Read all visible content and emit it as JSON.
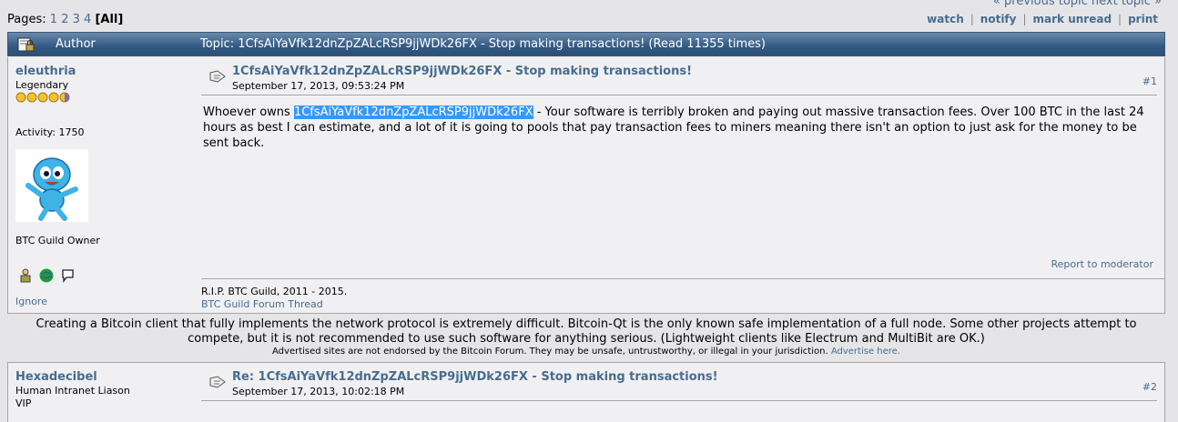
{
  "nav": {
    "prevnext": "« previous topic next topic »"
  },
  "pages": {
    "label": "Pages:",
    "items": [
      "1",
      "2",
      "3",
      "4"
    ],
    "current": "[All]"
  },
  "actions": [
    "watch",
    "notify",
    "mark unread",
    "print"
  ],
  "header": {
    "author_label": "Author",
    "topic_label": "Topic: 1CfsAiYaVfk12dnZpZALcRSP9jjWDk26FX - Stop making transactions!  (Read 11355 times)"
  },
  "posts": [
    {
      "author": "eleuthria",
      "rank": "Legendary",
      "activity": "Activity: 1750",
      "personal_title": "BTC Guild Owner",
      "ignore": "Ignore",
      "subject": "1CfsAiYaVfk12dnZpZALcRSP9jjWDk26FX - Stop making transactions!",
      "date": "September 17, 2013, 09:53:24 PM",
      "number": "#1",
      "content_prefix": "Whoever owns ",
      "content_highlight": "1CfsAiYaVfk12dnZpZALcRSP9jjWDk26FX",
      "content_suffix": " - Your software is terribly broken and paying out massive transaction fees.  Over 100 BTC in the last 24 hours as best I can estimate, and a lot of it is going to pools that pay transaction fees to miners meaning there isn't an option to just ask for the money to be sent back.",
      "report": "Report to moderator",
      "signature_line1": "R.I.P. BTC Guild, 2011 - 2015.",
      "signature_link": "BTC Guild Forum Thread"
    },
    {
      "author": "Hexadecibel",
      "rank": "Human Intranet Liason",
      "rank2": "VIP",
      "subject": "Re: 1CfsAiYaVfk12dnZpZALcRSP9jjWDk26FX - Stop making transactions!",
      "date": "September 17, 2013, 10:02:18 PM",
      "number": "#2"
    }
  ],
  "notice": "Creating a Bitcoin client that fully implements the network protocol is extremely difficult. Bitcoin-Qt is the only known safe implementation of a full node. Some other projects attempt to compete, but it is not recommended to use such software for anything serious. (Lightweight clients like Electrum and MultiBit are OK.)",
  "advert": {
    "text": "Advertised sites are not endorsed by the Bitcoin Forum. They may be unsafe, untrustworthy, or illegal in your jurisdiction.",
    "link": "Advertise here."
  },
  "icons": [
    "topic-lock-icon",
    "coin-star-icon",
    "post-subject-icon",
    "profile-icon",
    "website-globe-icon",
    "message-bubble-icon"
  ],
  "colors": {
    "link": "#476c8e",
    "header_bg": "#335a84",
    "post_bg": "#f0f0f3",
    "highlight": "#3399ff"
  }
}
